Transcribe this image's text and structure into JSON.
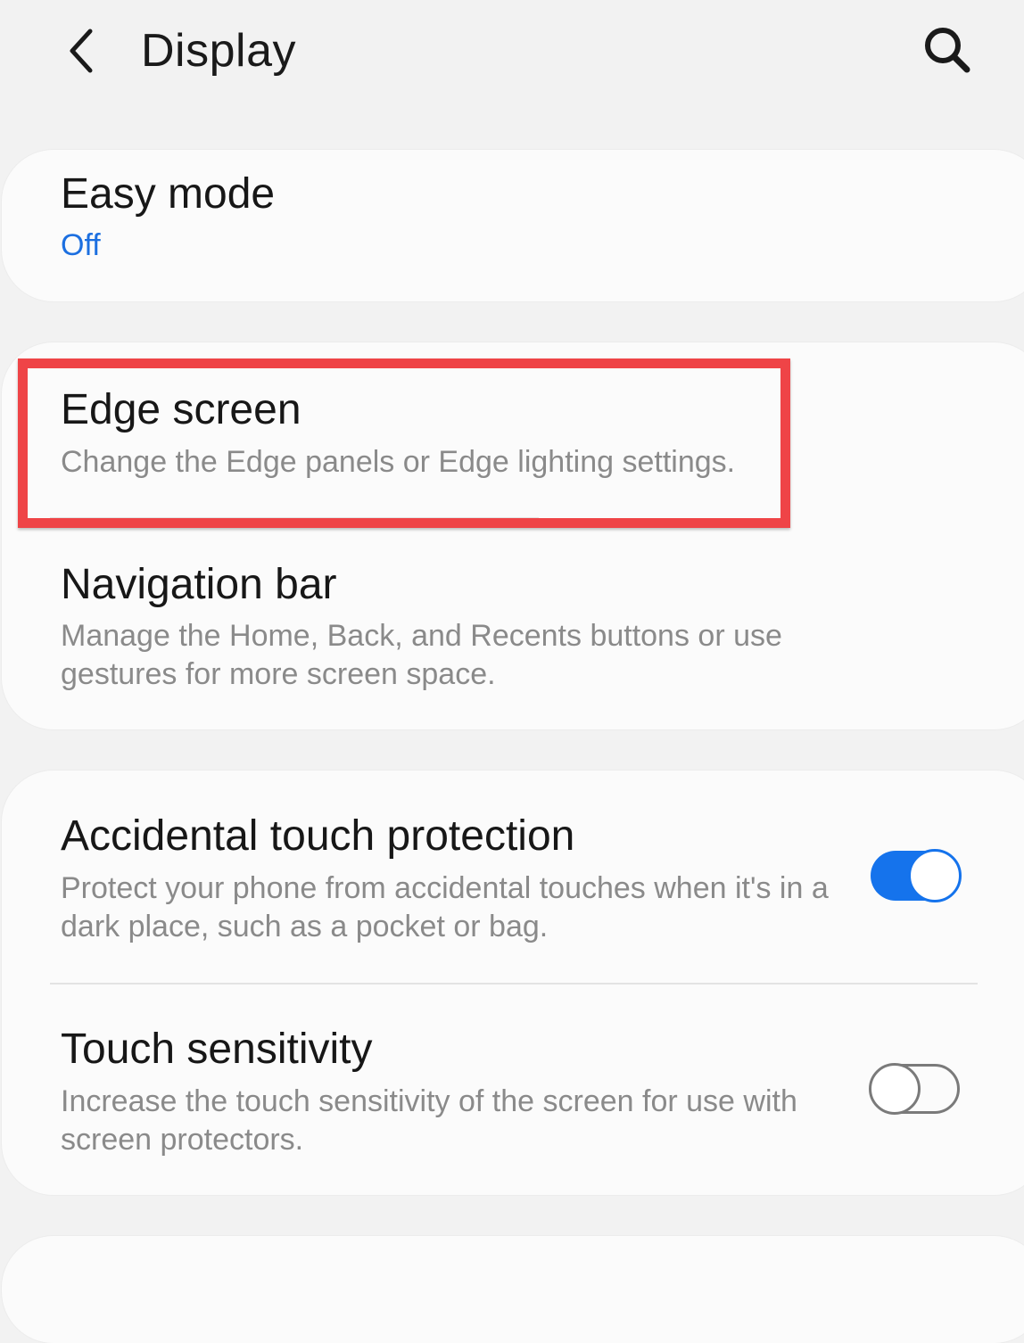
{
  "header": {
    "title": "Display",
    "back_icon": "chevron-left-icon",
    "search_icon": "search-icon"
  },
  "cards": [
    {
      "items": [
        {
          "title": "Easy mode",
          "value": "Off"
        }
      ]
    },
    {
      "items": [
        {
          "title": "Edge screen",
          "subtitle": "Change the Edge panels or Edge lighting settings."
        },
        {
          "title": "Navigation bar",
          "subtitle": "Manage the Home, Back, and Recents buttons or use gestures for more screen space."
        }
      ]
    },
    {
      "items": [
        {
          "title": "Accidental touch protection",
          "subtitle": "Protect your phone from accidental touches when it's in a dark place, such as a pocket or bag.",
          "toggle": true
        },
        {
          "title": "Touch sensitivity",
          "subtitle": "Increase the touch sensitivity of the screen for use with screen protectors.",
          "toggle": false
        }
      ]
    }
  ],
  "colors": {
    "accent": "#1573ec",
    "value_text": "#1c6fe0",
    "highlight": "#ef4447",
    "background": "#f2f2f2",
    "card": "#fbfbfb"
  }
}
